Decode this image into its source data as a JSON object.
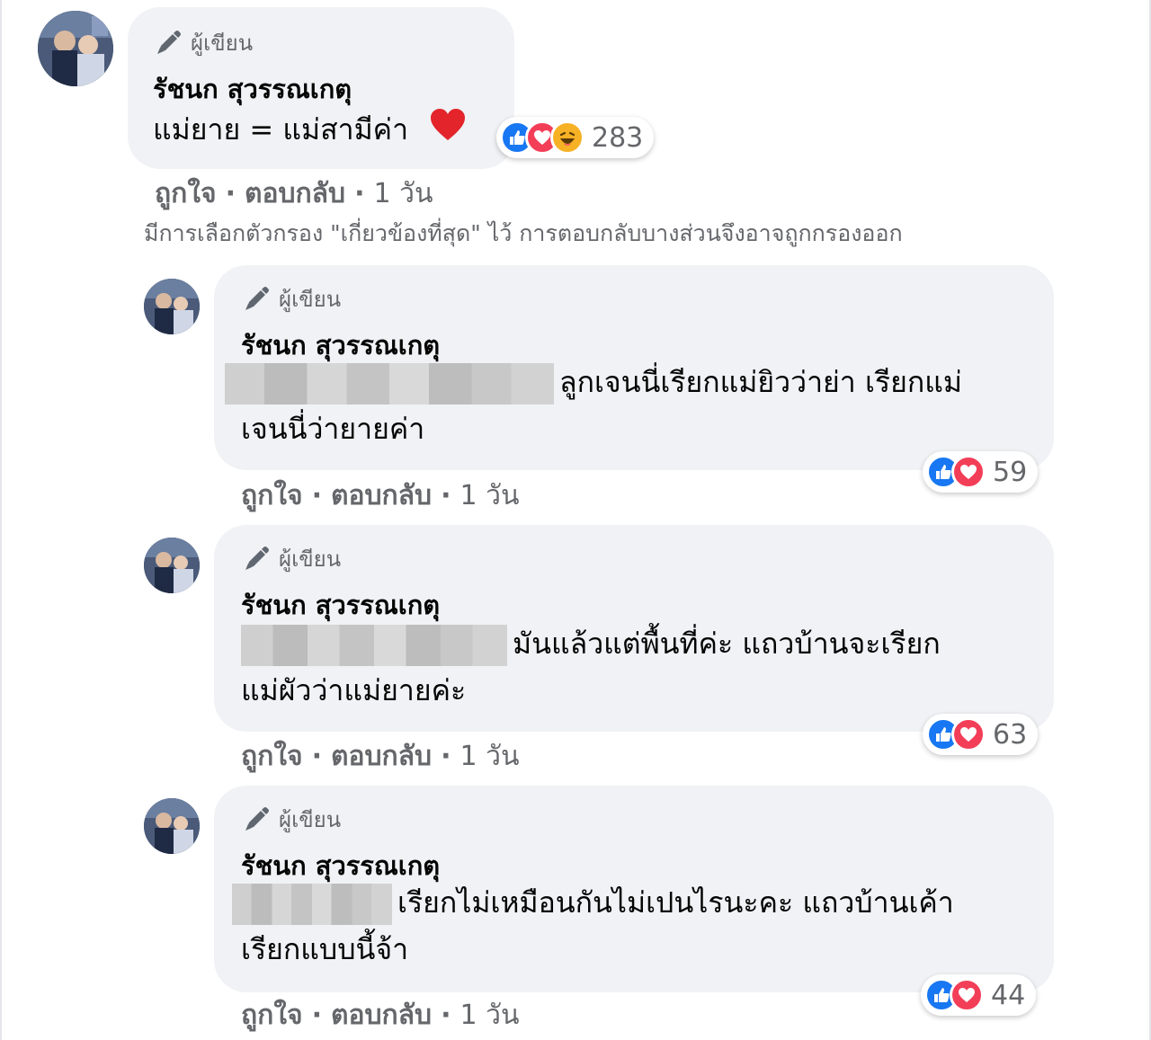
{
  "colors": {
    "like_blue": "#1877f2",
    "love_red": "#f33e58",
    "haha_yellow": "#f7b125",
    "bubble_bg": "#f0f2f5",
    "meta_text": "#65676b"
  },
  "author_badge_label": "ผู้เขียน",
  "author_badge_icon": "pencil-icon",
  "filter_note": "มีการเลือกตัวกรอง \"เกี่ยวข้องที่สุด\" ไว้ การตอบกลับบางส่วนจึงอาจถูกกรองออก",
  "main_comment": {
    "author": "รัชนก สุวรรณเกตุ",
    "text": "แม่ยาย = แม่สามีค่า",
    "emoji": "red-heart-emoji",
    "reactions": [
      "like",
      "love",
      "haha"
    ],
    "reaction_count": "283",
    "like_label": "ถูกใจ",
    "reply_label": "ตอบกลับ",
    "time": "1 วัน"
  },
  "replies": [
    {
      "author": "รัชนก สุวรรณเกตุ",
      "text_line1": "ลูกเจนนี่เรียกแม่ยิวว่าย่า เรียกแม่",
      "text_line2": "เจนนี่ว่ายายค่า",
      "reactions": [
        "like",
        "love"
      ],
      "reaction_count": "59",
      "like_label": "ถูกใจ",
      "reply_label": "ตอบกลับ",
      "time": "1 วัน"
    },
    {
      "author": "รัชนก สุวรรณเกตุ",
      "text_line1": "มันแล้วแต่พื้นที่ค่ะ แถวบ้านจะเรียก",
      "text_line2": "แม่ผัวว่าแม่ยายค่ะ",
      "reactions": [
        "like",
        "love"
      ],
      "reaction_count": "63",
      "like_label": "ถูกใจ",
      "reply_label": "ตอบกลับ",
      "time": "1 วัน"
    },
    {
      "author": "รัชนก สุวรรณเกตุ",
      "text_line1": "เรียกไม่เหมือนกันไม่เปนไรนะคะ แถวบ้านเค้า",
      "text_line2": "เรียกแบบนี้จ้า",
      "reactions": [
        "like",
        "love"
      ],
      "reaction_count": "44",
      "like_label": "ถูกใจ",
      "reply_label": "ตอบกลับ",
      "time": "1 วัน"
    }
  ]
}
